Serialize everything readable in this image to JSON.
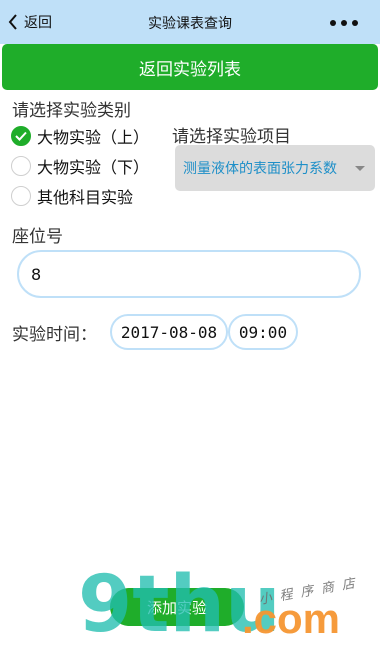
{
  "navbar": {
    "back_label": "返回",
    "title": "实验课表查询"
  },
  "buttons": {
    "back_to_list": "返回实验列表",
    "add_experiment": "添加实验"
  },
  "category": {
    "label": "请选择实验类别",
    "options": [
      {
        "label": "大物实验（上）",
        "checked": true
      },
      {
        "label": "大物实验（下）",
        "checked": false
      },
      {
        "label": "其他科目实验",
        "checked": false
      }
    ]
  },
  "project": {
    "label": "请选择实验项目",
    "selected": "测量液体的表面张力系数"
  },
  "seat": {
    "label": "座位号",
    "value": "8"
  },
  "time": {
    "label": "实验时间：",
    "date": "2017-08-08",
    "clock": "09:00"
  },
  "watermark": {
    "logo": "9thu",
    "domain": ".com",
    "tagline": "小程序商店"
  },
  "colors": {
    "navbar_bg": "#bfe0f8",
    "accent_green": "#1fad2a",
    "select_text": "#1e8fc8"
  }
}
